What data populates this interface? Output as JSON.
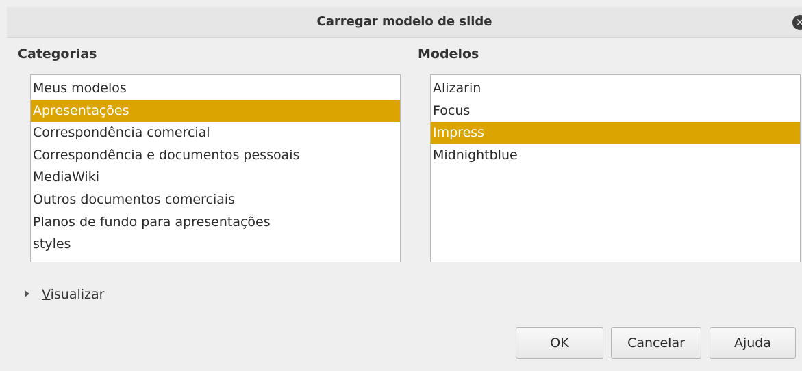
{
  "window": {
    "title": "Carregar modelo de slide"
  },
  "categories": {
    "label": "Categorias",
    "items": [
      "Meus modelos",
      "Apresentações",
      "Correspondência comercial",
      "Correspondência e documentos pessoais",
      "MediaWiki",
      "Outros documentos comerciais",
      "Planos de fundo para apresentações",
      "styles"
    ],
    "selected": "Apresentações"
  },
  "models": {
    "label": "Modelos",
    "items": [
      "Alizarin",
      "Focus",
      "Impress",
      "Midnightblue"
    ],
    "selected": "Impress"
  },
  "preview": {
    "label_mnemonic": "V",
    "label_rest": "isualizar"
  },
  "buttons": {
    "ok": {
      "mnemonic": "O",
      "rest": "K"
    },
    "cancel": {
      "mnemonic": "C",
      "rest": "ancelar"
    },
    "help": {
      "pre": "Aj",
      "mnemonic": "u",
      "rest": "da"
    }
  },
  "colors": {
    "selection": "#dca400",
    "background": "#efefef"
  },
  "icons": {
    "close": "close-circle-icon",
    "expander": "triangle-right-icon"
  }
}
